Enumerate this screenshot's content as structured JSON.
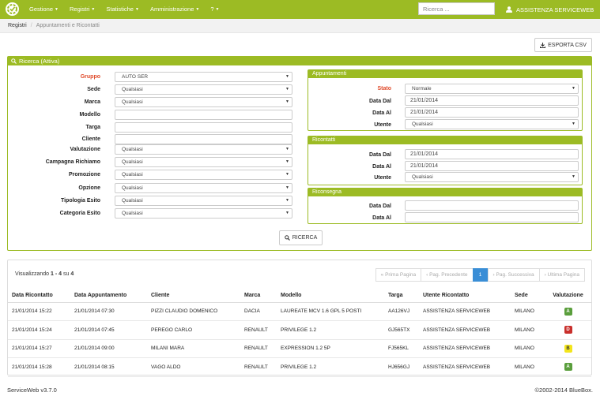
{
  "nav": {
    "menus": [
      {
        "label": "Gestione"
      },
      {
        "label": "Registri"
      },
      {
        "label": "Statistiche"
      },
      {
        "label": "Amministrazione"
      },
      {
        "label": "?"
      }
    ],
    "search_placeholder": "Ricerca ...",
    "user_name": "ASSISTENZA SERVICEWEB",
    "user_icon": "user-icon"
  },
  "breadcrumb": {
    "root": "Registri",
    "separator": "/",
    "current": "Appuntamenti e Ricontatti"
  },
  "export_button": "ESPORTA CSV",
  "search_panel": {
    "title": "Ricerca (Attiva)",
    "fields": [
      {
        "label": "Gruppo",
        "value": "AUTO SER",
        "type": "select",
        "required": true
      },
      {
        "label": "Sede",
        "value": "Qualsiasi",
        "type": "select"
      },
      {
        "label": "Marca",
        "value": "Qualsiasi",
        "type": "select"
      },
      {
        "label": "Modello",
        "value": "",
        "type": "text"
      },
      {
        "label": "Targa",
        "value": "",
        "type": "text"
      },
      {
        "label": "Cliente",
        "value": "",
        "type": "text"
      },
      {
        "label": "Valutazione",
        "value": "Qualsiasi",
        "type": "select"
      },
      {
        "label": "Campagna Richiamo",
        "value": "Qualsiasi",
        "type": "select"
      },
      {
        "label": "Promozione",
        "value": "Qualsiasi",
        "type": "select"
      },
      {
        "label": "Opzione",
        "value": "Qualsiasi",
        "type": "select"
      },
      {
        "label": "Tipologia Esito",
        "value": "Qualsiasi",
        "type": "select"
      },
      {
        "label": "Categoria Esito",
        "value": "Qualsiasi",
        "type": "select"
      }
    ],
    "appuntamenti": {
      "title": "Appuntamenti",
      "fields": [
        {
          "label": "Stato",
          "value": "Normale",
          "type": "select",
          "required": true
        },
        {
          "label": "Data Dal",
          "value": "21/01/2014",
          "type": "text"
        },
        {
          "label": "Data Al",
          "value": "21/01/2014",
          "type": "text"
        },
        {
          "label": "Utente",
          "value": "Qualsiasi",
          "type": "select"
        }
      ]
    },
    "ricontatti": {
      "title": "Ricontatti",
      "fields": [
        {
          "label": "Data Dal",
          "value": "21/01/2014",
          "type": "text"
        },
        {
          "label": "Data Al",
          "value": "21/01/2014",
          "type": "text"
        },
        {
          "label": "Utente",
          "value": "Qualsiasi",
          "type": "select"
        }
      ]
    },
    "riconsegna": {
      "title": "Riconsegna",
      "fields": [
        {
          "label": "Data Dal",
          "value": "",
          "type": "text"
        },
        {
          "label": "Data Al",
          "value": "",
          "type": "text"
        }
      ]
    },
    "search_button": "RICERCA"
  },
  "results": {
    "showing_prefix": "Visualizzando",
    "range": "1 - 4",
    "of_word": "su",
    "total": "4",
    "pagination": {
      "first": "« Prima Pagina",
      "prev": "‹ Pag. Precedente",
      "current": "1",
      "next": "› Pag. Successiva",
      "last": "› Ultima Pagina"
    },
    "columns": [
      "Data Ricontatto",
      "Data Appuntamento",
      "Cliente",
      "Marca",
      "Modello",
      "Targa",
      "Utente Ricontatto",
      "Sede",
      "Valutazione"
    ],
    "rows": [
      {
        "data_ricontatto": "21/01/2014 15:22",
        "data_appuntamento": "21/01/2014 07:30",
        "cliente": "PIZZI CLAUDIO DOMENICO",
        "marca": "DACIA",
        "modello": "LAUREATE MCV 1.6 GPL 5 POSTI",
        "targa": "AA126VJ",
        "utente": "ASSISTENZA SERVICEWEB",
        "sede": "MILANO",
        "valutazione": "A",
        "val_color": "#5a9e3c"
      },
      {
        "data_ricontatto": "21/01/2014 15:24",
        "data_appuntamento": "21/01/2014 07:45",
        "cliente": "PEREGO CARLO",
        "marca": "RENAULT",
        "modello": "PRIVILEGE 1.2",
        "targa": "GJ565TX",
        "utente": "ASSISTENZA SERVICEWEB",
        "sede": "MILANO",
        "valutazione": "D",
        "val_color": "#c9302c"
      },
      {
        "data_ricontatto": "21/01/2014 15:27",
        "data_appuntamento": "21/01/2014 09:00",
        "cliente": "MILANI MARA",
        "marca": "RENAULT",
        "modello": "EXPRESSION 1.2 5P",
        "targa": "FJ565KL",
        "utente": "ASSISTENZA SERVICEWEB",
        "sede": "MILANO",
        "valutazione": "B",
        "val_color": "#f3e51c"
      },
      {
        "data_ricontatto": "21/01/2014 15:28",
        "data_appuntamento": "21/01/2014 08:15",
        "cliente": "VAGO ALDO",
        "marca": "RENAULT",
        "modello": "PRIVILEGE 1.2",
        "targa": "HJ656GJ",
        "utente": "ASSISTENZA SERVICEWEB",
        "sede": "MILANO",
        "valutazione": "A",
        "val_color": "#5a9e3c"
      }
    ]
  },
  "footer": {
    "version": "ServiceWeb v3.7.0",
    "copyright": "©2002-2014 BlueBox."
  },
  "colors": {
    "brand_green": "#9cbb24",
    "active_page": "#3a8ed6",
    "required_label": "#e04a2a"
  }
}
